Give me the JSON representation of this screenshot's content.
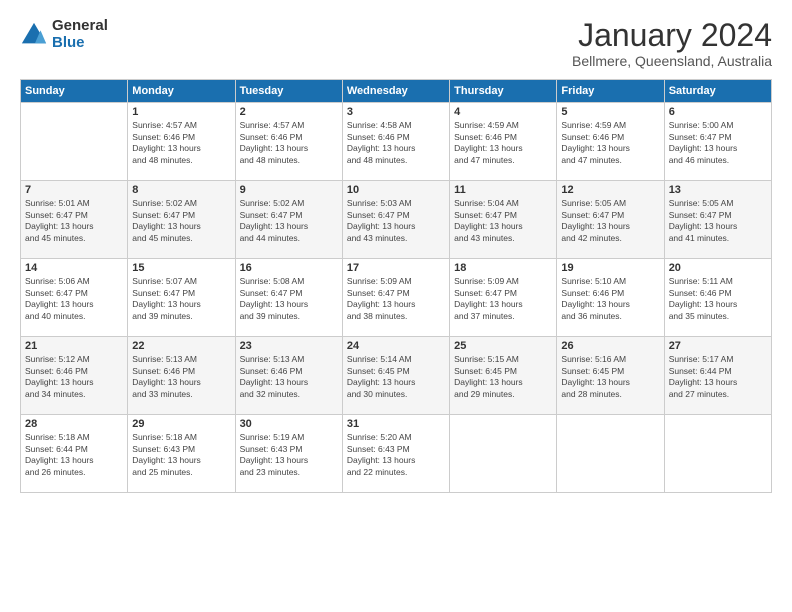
{
  "header": {
    "logo_general": "General",
    "logo_blue": "Blue",
    "month_title": "January 2024",
    "location": "Bellmere, Queensland, Australia"
  },
  "days_of_week": [
    "Sunday",
    "Monday",
    "Tuesday",
    "Wednesday",
    "Thursday",
    "Friday",
    "Saturday"
  ],
  "weeks": [
    [
      {
        "day": "",
        "detail": ""
      },
      {
        "day": "1",
        "detail": "Sunrise: 4:57 AM\nSunset: 6:46 PM\nDaylight: 13 hours\nand 48 minutes."
      },
      {
        "day": "2",
        "detail": "Sunrise: 4:57 AM\nSunset: 6:46 PM\nDaylight: 13 hours\nand 48 minutes."
      },
      {
        "day": "3",
        "detail": "Sunrise: 4:58 AM\nSunset: 6:46 PM\nDaylight: 13 hours\nand 48 minutes."
      },
      {
        "day": "4",
        "detail": "Sunrise: 4:59 AM\nSunset: 6:46 PM\nDaylight: 13 hours\nand 47 minutes."
      },
      {
        "day": "5",
        "detail": "Sunrise: 4:59 AM\nSunset: 6:46 PM\nDaylight: 13 hours\nand 47 minutes."
      },
      {
        "day": "6",
        "detail": "Sunrise: 5:00 AM\nSunset: 6:47 PM\nDaylight: 13 hours\nand 46 minutes."
      }
    ],
    [
      {
        "day": "7",
        "detail": "Sunrise: 5:01 AM\nSunset: 6:47 PM\nDaylight: 13 hours\nand 45 minutes."
      },
      {
        "day": "8",
        "detail": "Sunrise: 5:02 AM\nSunset: 6:47 PM\nDaylight: 13 hours\nand 45 minutes."
      },
      {
        "day": "9",
        "detail": "Sunrise: 5:02 AM\nSunset: 6:47 PM\nDaylight: 13 hours\nand 44 minutes."
      },
      {
        "day": "10",
        "detail": "Sunrise: 5:03 AM\nSunset: 6:47 PM\nDaylight: 13 hours\nand 43 minutes."
      },
      {
        "day": "11",
        "detail": "Sunrise: 5:04 AM\nSunset: 6:47 PM\nDaylight: 13 hours\nand 43 minutes."
      },
      {
        "day": "12",
        "detail": "Sunrise: 5:05 AM\nSunset: 6:47 PM\nDaylight: 13 hours\nand 42 minutes."
      },
      {
        "day": "13",
        "detail": "Sunrise: 5:05 AM\nSunset: 6:47 PM\nDaylight: 13 hours\nand 41 minutes."
      }
    ],
    [
      {
        "day": "14",
        "detail": "Sunrise: 5:06 AM\nSunset: 6:47 PM\nDaylight: 13 hours\nand 40 minutes."
      },
      {
        "day": "15",
        "detail": "Sunrise: 5:07 AM\nSunset: 6:47 PM\nDaylight: 13 hours\nand 39 minutes."
      },
      {
        "day": "16",
        "detail": "Sunrise: 5:08 AM\nSunset: 6:47 PM\nDaylight: 13 hours\nand 39 minutes."
      },
      {
        "day": "17",
        "detail": "Sunrise: 5:09 AM\nSunset: 6:47 PM\nDaylight: 13 hours\nand 38 minutes."
      },
      {
        "day": "18",
        "detail": "Sunrise: 5:09 AM\nSunset: 6:47 PM\nDaylight: 13 hours\nand 37 minutes."
      },
      {
        "day": "19",
        "detail": "Sunrise: 5:10 AM\nSunset: 6:46 PM\nDaylight: 13 hours\nand 36 minutes."
      },
      {
        "day": "20",
        "detail": "Sunrise: 5:11 AM\nSunset: 6:46 PM\nDaylight: 13 hours\nand 35 minutes."
      }
    ],
    [
      {
        "day": "21",
        "detail": "Sunrise: 5:12 AM\nSunset: 6:46 PM\nDaylight: 13 hours\nand 34 minutes."
      },
      {
        "day": "22",
        "detail": "Sunrise: 5:13 AM\nSunset: 6:46 PM\nDaylight: 13 hours\nand 33 minutes."
      },
      {
        "day": "23",
        "detail": "Sunrise: 5:13 AM\nSunset: 6:46 PM\nDaylight: 13 hours\nand 32 minutes."
      },
      {
        "day": "24",
        "detail": "Sunrise: 5:14 AM\nSunset: 6:45 PM\nDaylight: 13 hours\nand 30 minutes."
      },
      {
        "day": "25",
        "detail": "Sunrise: 5:15 AM\nSunset: 6:45 PM\nDaylight: 13 hours\nand 29 minutes."
      },
      {
        "day": "26",
        "detail": "Sunrise: 5:16 AM\nSunset: 6:45 PM\nDaylight: 13 hours\nand 28 minutes."
      },
      {
        "day": "27",
        "detail": "Sunrise: 5:17 AM\nSunset: 6:44 PM\nDaylight: 13 hours\nand 27 minutes."
      }
    ],
    [
      {
        "day": "28",
        "detail": "Sunrise: 5:18 AM\nSunset: 6:44 PM\nDaylight: 13 hours\nand 26 minutes."
      },
      {
        "day": "29",
        "detail": "Sunrise: 5:18 AM\nSunset: 6:43 PM\nDaylight: 13 hours\nand 25 minutes."
      },
      {
        "day": "30",
        "detail": "Sunrise: 5:19 AM\nSunset: 6:43 PM\nDaylight: 13 hours\nand 23 minutes."
      },
      {
        "day": "31",
        "detail": "Sunrise: 5:20 AM\nSunset: 6:43 PM\nDaylight: 13 hours\nand 22 minutes."
      },
      {
        "day": "",
        "detail": ""
      },
      {
        "day": "",
        "detail": ""
      },
      {
        "day": "",
        "detail": ""
      }
    ]
  ]
}
